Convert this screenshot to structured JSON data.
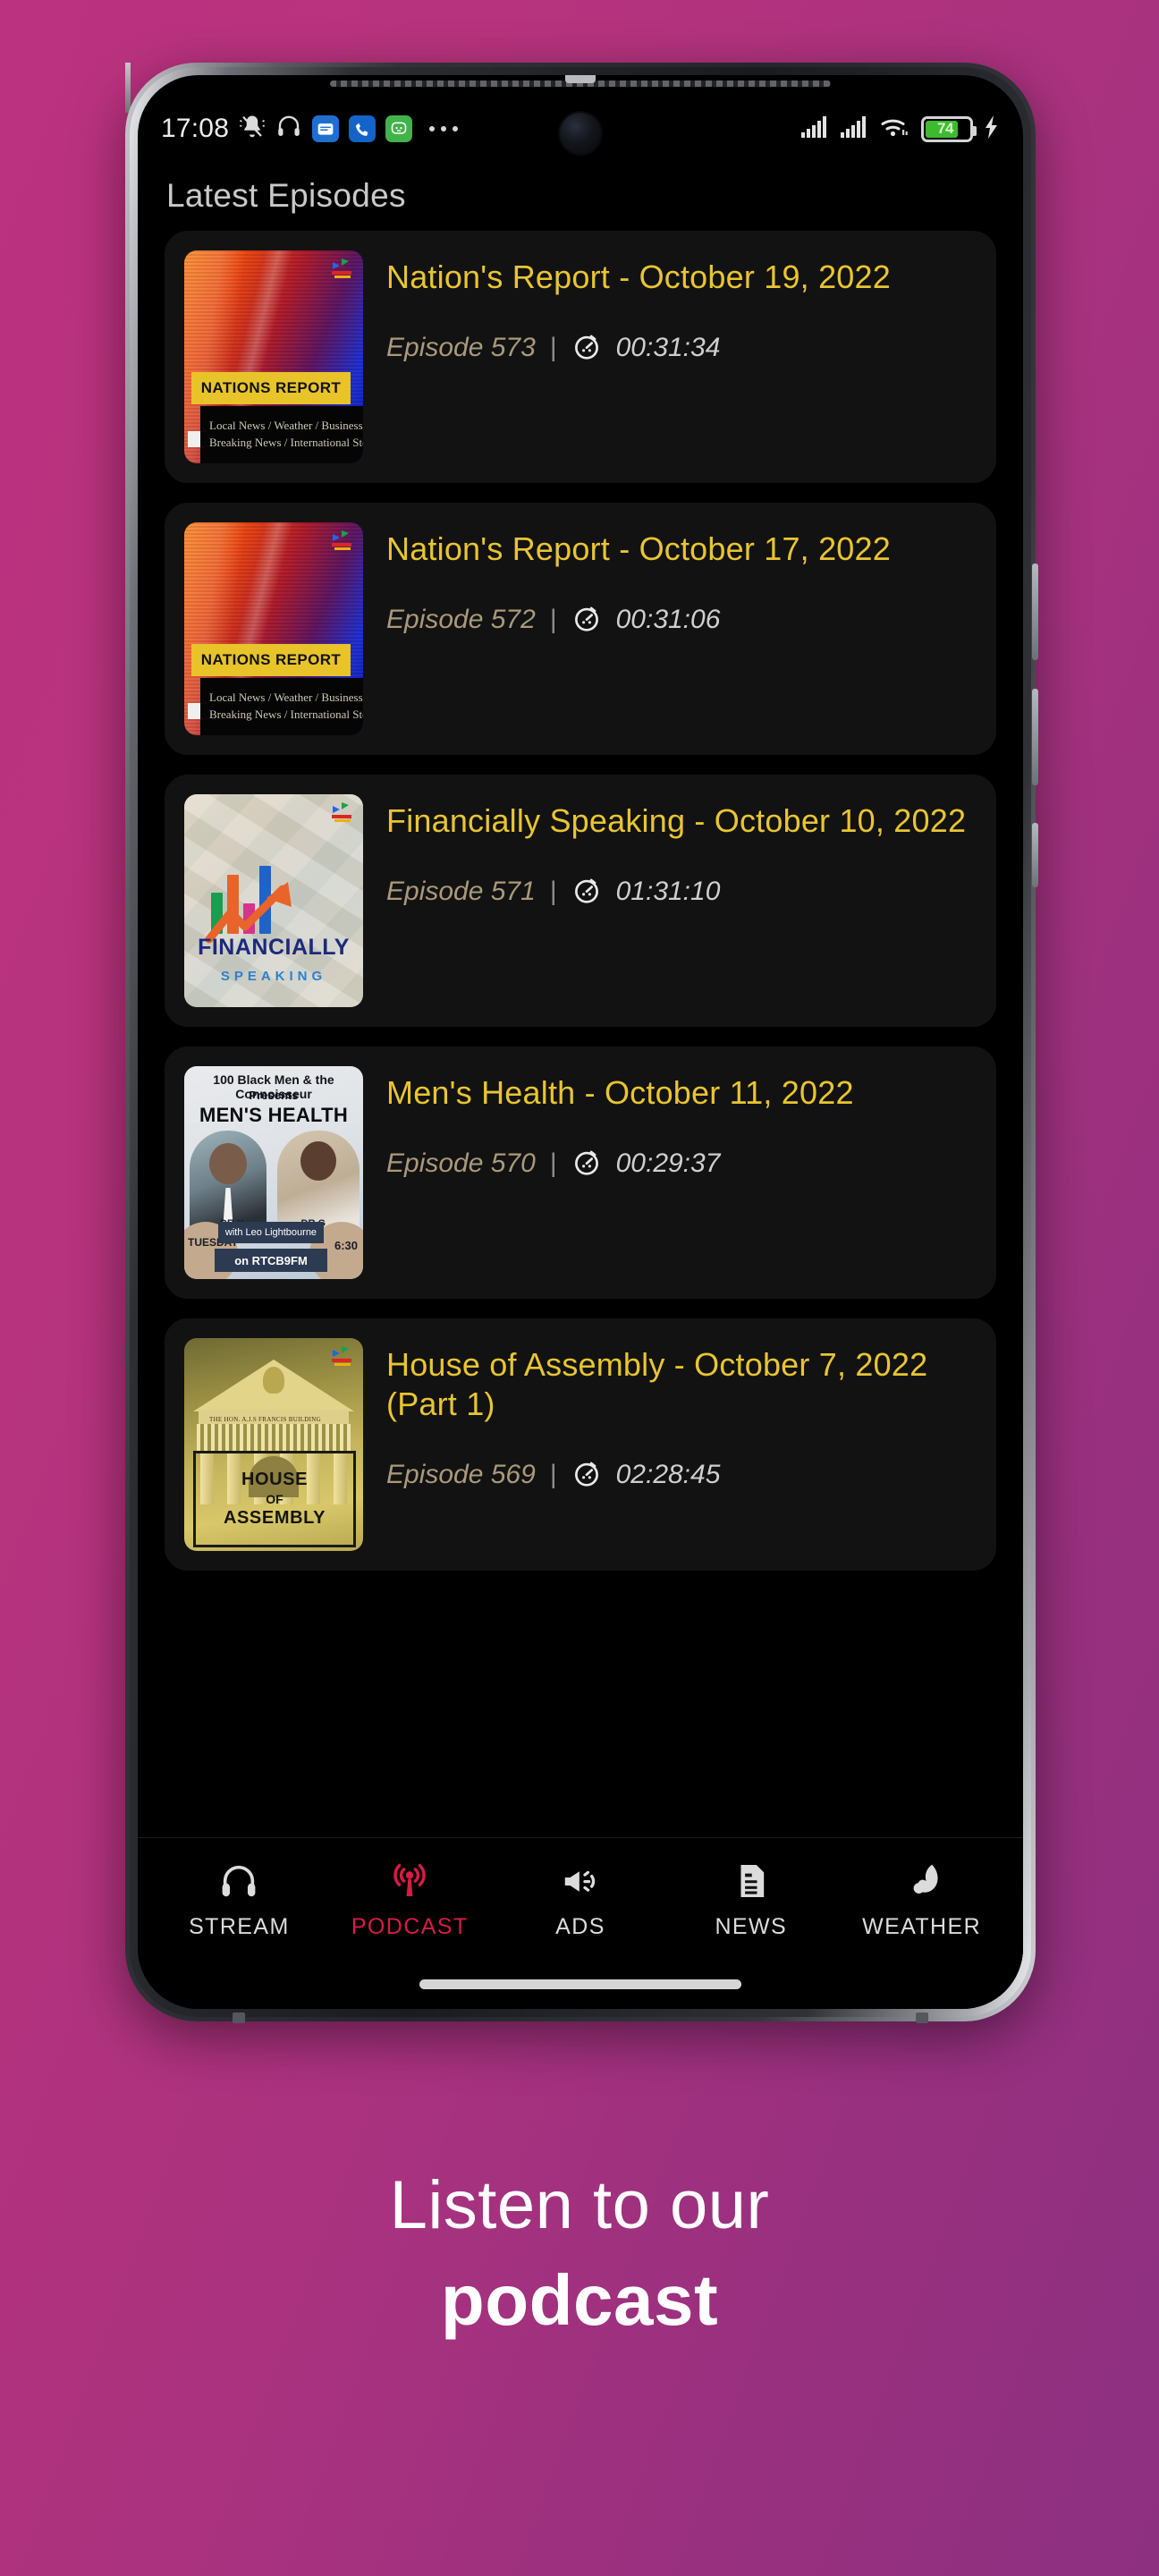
{
  "background": {
    "left_color": "#bb3280",
    "right_color": "#8e3080"
  },
  "status_bar": {
    "time": "17:08",
    "left_icons": [
      "bell-muted-icon",
      "headset-icon",
      "messages-app-icon",
      "phone-app-icon",
      "whatsapp-app-icon",
      "more-dots-icon"
    ],
    "right_icons": [
      "signal-sim1-icon",
      "signal-sim2-icon",
      "wifi-icon",
      "battery-icon",
      "charging-bolt-icon"
    ],
    "battery_percent": "74",
    "battery_level": 74,
    "charging": true
  },
  "app": {
    "title": "Latest Episodes",
    "accent_title_color": "#e8c531",
    "episodes": [
      {
        "title": "Nation's Report - October 19, 2022",
        "episode_label": "Episode 573",
        "separator": "|",
        "duration": "00:31:34",
        "thumb_type": "nations",
        "thumb_banner": "NATIONS REPORT",
        "thumb_line1": "Local  News / Weather / Business /",
        "thumb_line2": "Breaking News / International Storie"
      },
      {
        "title": "Nation's Report - October 17, 2022",
        "episode_label": "Episode 572",
        "separator": "|",
        "duration": "00:31:06",
        "thumb_type": "nations",
        "thumb_banner": "NATIONS REPORT",
        "thumb_line1": "Local  News / Weather / Business /",
        "thumb_line2": "Breaking News / International Storie"
      },
      {
        "title": "Financially Speaking - October 10, 2022",
        "episode_label": "Episode 571",
        "separator": "|",
        "duration": "01:31:10",
        "thumb_type": "financially",
        "thumb_name": "FINANCIALLY",
        "thumb_sub": "SPEAKING"
      },
      {
        "title": "Men's Health - October 11, 2022",
        "episode_label": "Episode 570",
        "separator": "|",
        "duration": "00:29:37",
        "thumb_type": "mens",
        "mh_line1": "100 Black Men & the Connoisseur",
        "mh_line2": "Presents",
        "mh_line3": "MEN'S HEALTH",
        "mh_drk": "DR.K",
        "mh_drg": "DR.G",
        "mh_day": "TUESDAY",
        "mh_time": "6:30",
        "mh_host": "with Leo Lightbourne",
        "mh_station": "on RTCB9FM"
      },
      {
        "title": "House of Assembly - October 7, 2022 (Part 1)",
        "episode_label": "Episode 569",
        "separator": "|",
        "duration": "02:28:45",
        "thumb_type": "house",
        "hoa_engraved": "THE HON. A.J.S FRANCIS BUILDING",
        "hoa_l1": "HOUSE",
        "hoa_l2": "OF",
        "hoa_l3": "ASSEMBLY"
      }
    ],
    "nav": {
      "active_color": "#d81b46",
      "items": [
        {
          "label": "STREAM",
          "icon": "headphones-icon",
          "active": false
        },
        {
          "label": "PODCAST",
          "icon": "broadcast-icon",
          "active": true
        },
        {
          "label": "ADS",
          "icon": "megaphone-icon",
          "active": false
        },
        {
          "label": "NEWS",
          "icon": "document-icon",
          "active": false
        },
        {
          "label": "WEATHER",
          "icon": "moon-cloud-icon",
          "active": false
        }
      ]
    }
  },
  "caption": {
    "line1": "Listen to our",
    "line2": "podcast"
  }
}
